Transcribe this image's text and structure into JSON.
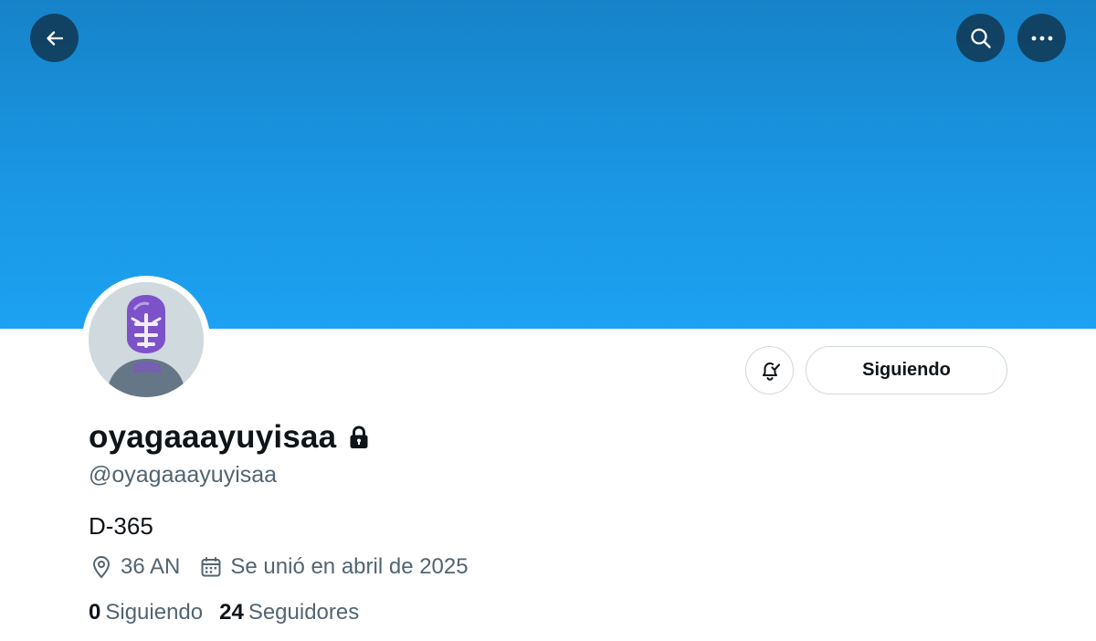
{
  "header": {
    "back_icon": "arrow-left-icon",
    "search_icon": "search-icon",
    "more_icon": "more-horizontal-icon",
    "banner_color": "#1da1f2",
    "button_overlay_color": "#0f283c"
  },
  "profile": {
    "display_name": "oyagaaayuyisaa",
    "protected_icon": "lock-icon",
    "handle": "@oyagaaayuyisaa",
    "bio": "D-365",
    "location": "36 AN",
    "location_icon": "map-pin-icon",
    "joined": "Se unió en abril de 2025",
    "joined_icon": "calendar-icon"
  },
  "actions": {
    "notifications_icon": "bell-check-icon",
    "follow_label": "Siguiendo"
  },
  "stats": {
    "following_count": "0",
    "following_label": "Siguiendo",
    "followers_count": "24",
    "followers_label": "Seguidores"
  }
}
